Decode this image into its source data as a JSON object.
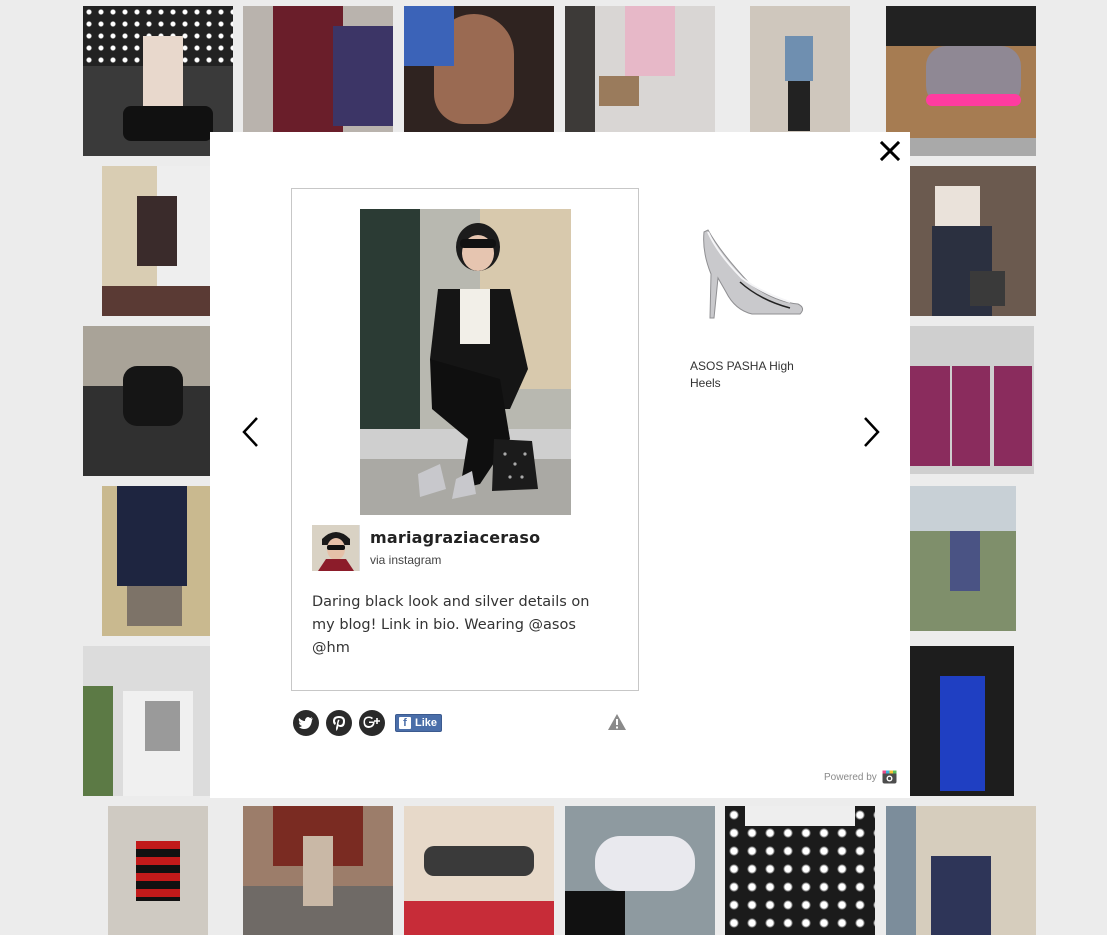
{
  "lightbox": {
    "close_label": "×",
    "post": {
      "username": "mariagraziaceraso",
      "source": "via instagram",
      "caption": "Daring black look and silver details on my blog! Link in bio. Wearing @asos @hm"
    },
    "share": {
      "icons": [
        "twitter-icon",
        "pinterest-icon",
        "google-plus-icon"
      ],
      "like_label": "Like"
    },
    "product": {
      "name": "ASOS PASHA High Heels",
      "icon": "silver-heel-shoe"
    },
    "powered_by": "Powered by"
  },
  "colors": {
    "page_bg": "#ececec",
    "modal_bg": "#ffffff",
    "facebook": "#4a6ea9",
    "icon_dark": "#2a2a2a"
  }
}
